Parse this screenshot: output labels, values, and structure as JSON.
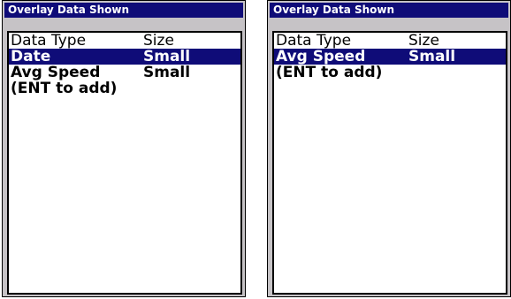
{
  "screens": [
    {
      "title": "Overlay Data Shown",
      "columns": {
        "type": "Data Type",
        "size": "Size"
      },
      "rows": [
        {
          "type": "Date",
          "size": "Small",
          "selected": true
        },
        {
          "type": "Avg Speed",
          "size": "Small",
          "selected": false
        }
      ],
      "hint": "(ENT to add)"
    },
    {
      "title": "Overlay Data Shown",
      "columns": {
        "type": "Data Type",
        "size": "Size"
      },
      "rows": [
        {
          "type": "Avg Speed",
          "size": "Small",
          "selected": true
        }
      ],
      "hint": "(ENT to add)"
    }
  ],
  "colors": {
    "title_bar": "#0f0c78",
    "selection": "#0f0c78",
    "frame": "#c6c3c6",
    "list_background": "#ffffff"
  }
}
